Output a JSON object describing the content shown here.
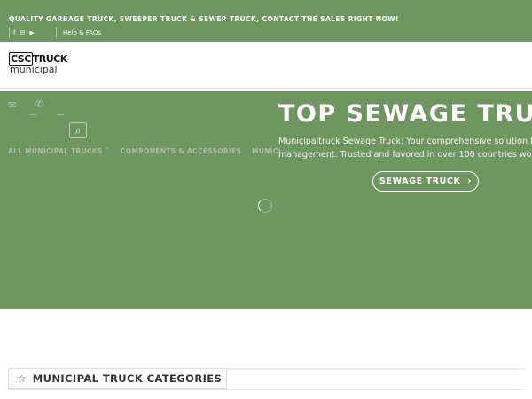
{
  "topbar": {
    "promo": "QUALITY GARBAGE TRUCK, SWEEPER TRUCK & SEWER TRUCK, CONTACT THE SALES RIGHT NOW!",
    "social": [
      {
        "name": "facebook-icon",
        "glyph": "f"
      },
      {
        "name": "email-icon",
        "glyph": "✉"
      },
      {
        "name": "youtube-icon",
        "glyph": "▶"
      }
    ],
    "help": "Help & FAQs"
  },
  "logo": {
    "line1_box": "CSC",
    "line1": "TRUCK",
    "line2": "municipal"
  },
  "header": {
    "email_icon": "✉",
    "phone_icon": "✆",
    "search_icon": "⌕"
  },
  "nav": [
    {
      "label": "ALL MUNICIPAL TRUCKS ˅"
    },
    {
      "label": "COMPONENTS & ACCESSORIES"
    },
    {
      "label": "MUNICI"
    }
  ],
  "hero": {
    "title": "TOP SEWAGE TRU",
    "desc_line1": "Municipaltruck Sewage Truck: Your comprehensive solution fo",
    "desc_line2": "management. Trusted and favored in over 100 countries wo",
    "cta_label": "SEWAGE TRUCK",
    "cta_chevron": "›"
  },
  "section": {
    "star_icon": "☆",
    "title": "MUNICIPAL TRUCK CATEGORIES"
  },
  "colors": {
    "brand_green": "#6f9660",
    "text_dark": "#333333"
  }
}
